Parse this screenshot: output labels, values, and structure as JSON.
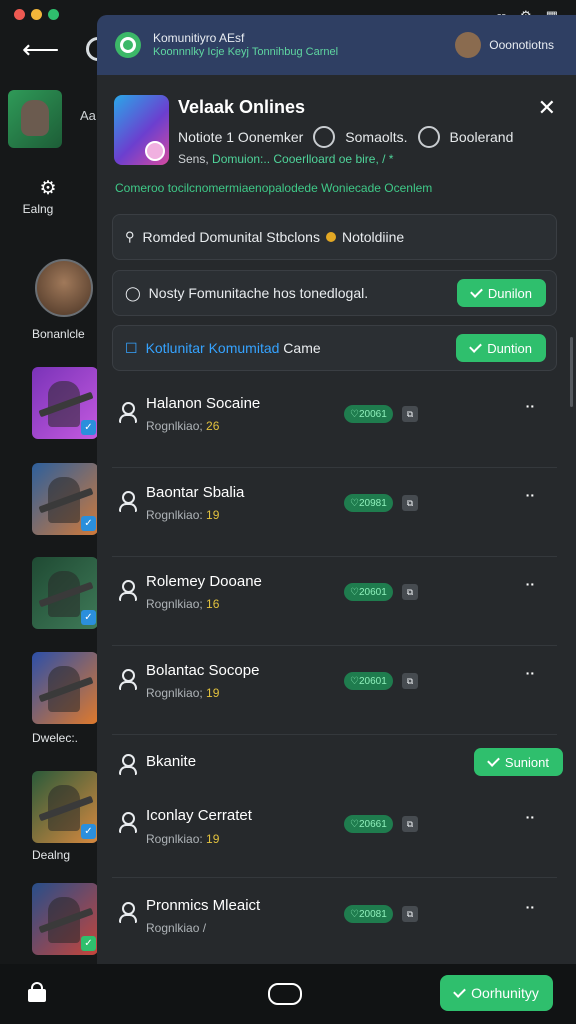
{
  "colors": {
    "accent": "#2fbf6d",
    "header": "#2f3f63",
    "link": "#35a3ff"
  },
  "window": {
    "controls": [
      "close",
      "minimize",
      "maximize"
    ]
  },
  "topbar": {
    "back_icon": "back-arrow-icon"
  },
  "sidebar": {
    "main_label": "Aa",
    "items": [
      {
        "label": "Ealng",
        "icon": "gear-icon"
      },
      {
        "label": "Bonanlcle"
      },
      {
        "label": "Dwelec:."
      },
      {
        "label": "Dealng"
      }
    ]
  },
  "panel": {
    "header_title": "Komunitiyro AEsf",
    "header_subtitle": "Koonnnlky Icje Keyj Tonnihbug Carnel",
    "header_user": "Ooonotiotns",
    "game_title": "Velaak Onlines",
    "stat1": "Notiote 1 Oonemker",
    "stat2": "Somaolts.",
    "stat3": "Boolerand",
    "series_prefix": "Sens, ",
    "series_green": "Domuion:.. Cooerlloard oe bire, /",
    "description": "Comeroo tocilcnomermiaenopalodede Woniecade Ocenlem",
    "search_text": "Romded Domunital Stbclons",
    "search_suffix": "Notoldiine",
    "row2_text": "Nosty Fomunitache hos tonedlogal.",
    "row2_button": "Dunilon",
    "row3_link": "Kotlunitar Komumitad",
    "row3_text": "Came",
    "row3_button": "Duntion",
    "players": [
      {
        "name": "Halanon Socaine",
        "sub": "Rognlkiao; ",
        "num": "26",
        "tag": "20061"
      },
      {
        "name": "Baontar Sbalia",
        "sub": "Rognlkiao: ",
        "num": "19",
        "tag": "20981"
      },
      {
        "name": "Rolemey Dooane",
        "sub": "Rognlkiao; ",
        "num": "16",
        "tag": "20601"
      },
      {
        "name": "Bolantac Socope",
        "sub": "Rognlkiao; ",
        "num": "19",
        "tag": "20601"
      }
    ],
    "section_title": "Bkanite",
    "section_button": "Suniont",
    "players2": [
      {
        "name": "Iconlay Cerratet",
        "sub": "Rognlkiao: ",
        "num": "19",
        "tag": "20661"
      },
      {
        "name": "Pronmics Mleaict",
        "sub": "Rognlkiao /",
        "num": "",
        "tag": "20081"
      }
    ]
  },
  "bottom": {
    "community_button": "Oorhunityy"
  }
}
